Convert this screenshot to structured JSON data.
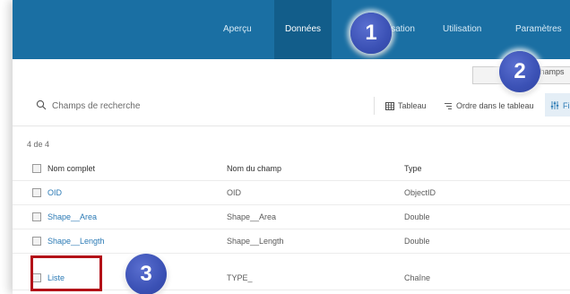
{
  "nav": {
    "tabs": [
      {
        "label": "Aperçu"
      },
      {
        "label": "Données"
      },
      {
        "label": "isation"
      },
      {
        "label": "Utilisation"
      },
      {
        "label": "Paramètres"
      }
    ],
    "active": "Données"
  },
  "subbar": {
    "fields_label": "Champs"
  },
  "search": {
    "placeholder": "Champs de recherche"
  },
  "toolbar": {
    "table_label": "Tableau",
    "order_label": "Ordre dans le tableau",
    "filter_label": "Filtre"
  },
  "table": {
    "count": "4 de 4",
    "columns": [
      "Nom complet",
      "Nom du champ",
      "Type"
    ],
    "rows": [
      {
        "alias": "OID",
        "name": "OID",
        "type": "ObjectID"
      },
      {
        "alias": "Shape__Area",
        "name": "Shape__Area",
        "type": "Double"
      },
      {
        "alias": "Shape__Length",
        "name": "Shape__Length",
        "type": "Double"
      },
      {
        "alias": "Liste",
        "name": "TYPE_",
        "type": "Chaîne"
      }
    ]
  },
  "callouts": [
    "1",
    "2",
    "3"
  ],
  "colors": {
    "topbar": "#1a6fa3",
    "topbar_active": "#125d8a",
    "link": "#2b7ab5",
    "badge": "#3b51b5",
    "highlight": "#b31018"
  }
}
